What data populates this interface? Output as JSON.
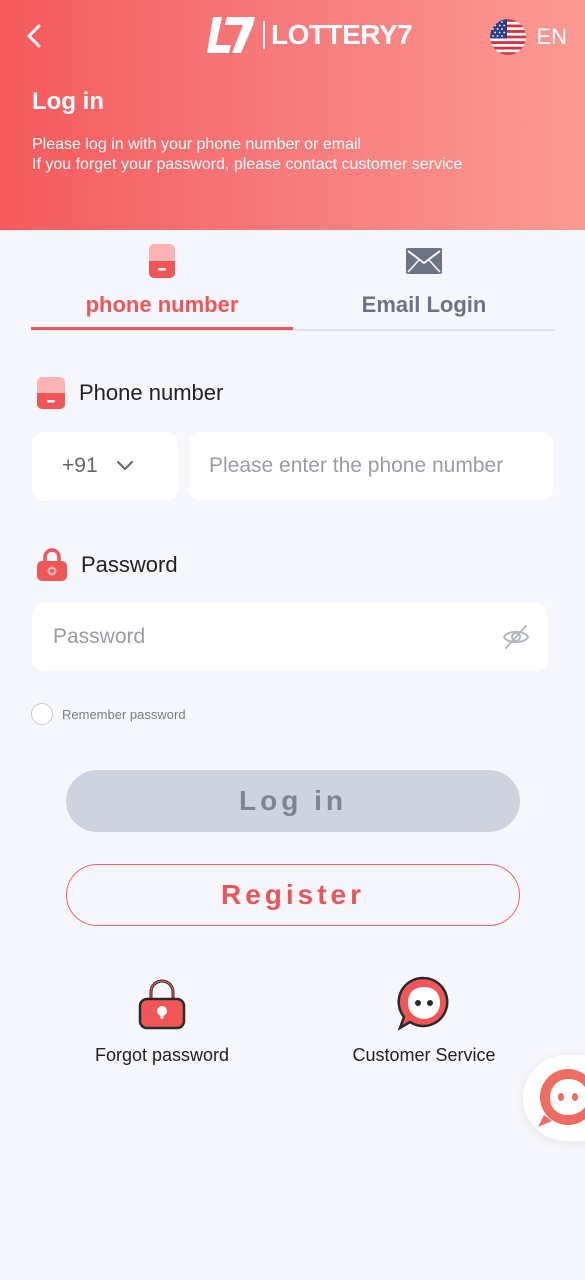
{
  "header": {
    "brand_name": "LOTTERY7",
    "language": "EN",
    "title": "Log in",
    "subtitle_line1": "Please log in with your phone number or email",
    "subtitle_line2": "If you forget your password, please contact customer service"
  },
  "tabs": [
    {
      "label": "phone number",
      "icon": "phone-icon",
      "active": true
    },
    {
      "label": "Email Login",
      "icon": "envelope-icon",
      "active": false
    }
  ],
  "form": {
    "phone_label": "Phone number",
    "country_code": "+91",
    "phone_placeholder": "Please enter the phone number",
    "password_label": "Password",
    "password_placeholder": "Password",
    "remember_label": "Remember password",
    "login_label": "Log in",
    "register_label": "Register"
  },
  "quick_links": {
    "forgot_label": "Forgot password",
    "service_label": "Customer Service"
  },
  "colors": {
    "accent": "#f05558",
    "header_gradient_start": "#f65a5c",
    "header_gradient_end": "#fb9a92",
    "login_disabled_bg": "#cfd2df",
    "page_bg": "#f6f7fc"
  }
}
